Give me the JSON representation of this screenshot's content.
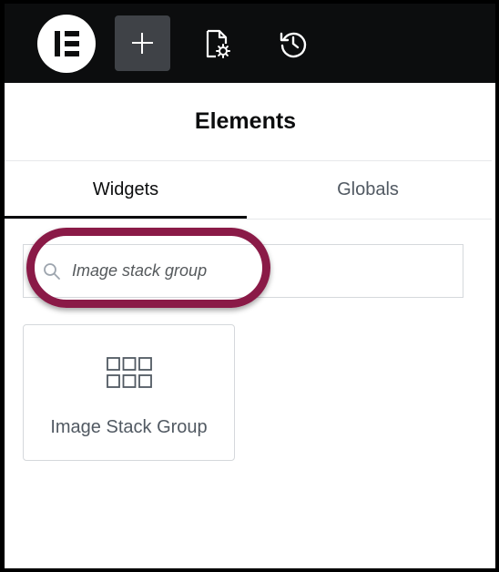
{
  "topbar": {
    "logo_icon": "elementor-logo-icon",
    "add_icon": "plus-icon",
    "page_settings_icon": "document-gear-icon",
    "history_icon": "history-icon",
    "accent_color": "#3f4247"
  },
  "panel": {
    "title": "Elements"
  },
  "tabs": [
    {
      "label": "Widgets",
      "active": true
    },
    {
      "label": "Globals",
      "active": false
    }
  ],
  "search": {
    "value": "Image stack group",
    "icon": "search-icon",
    "highlight_color": "#8a1a47"
  },
  "widgets": [
    {
      "label": "Image Stack Group",
      "icon": "grid-icon"
    }
  ]
}
